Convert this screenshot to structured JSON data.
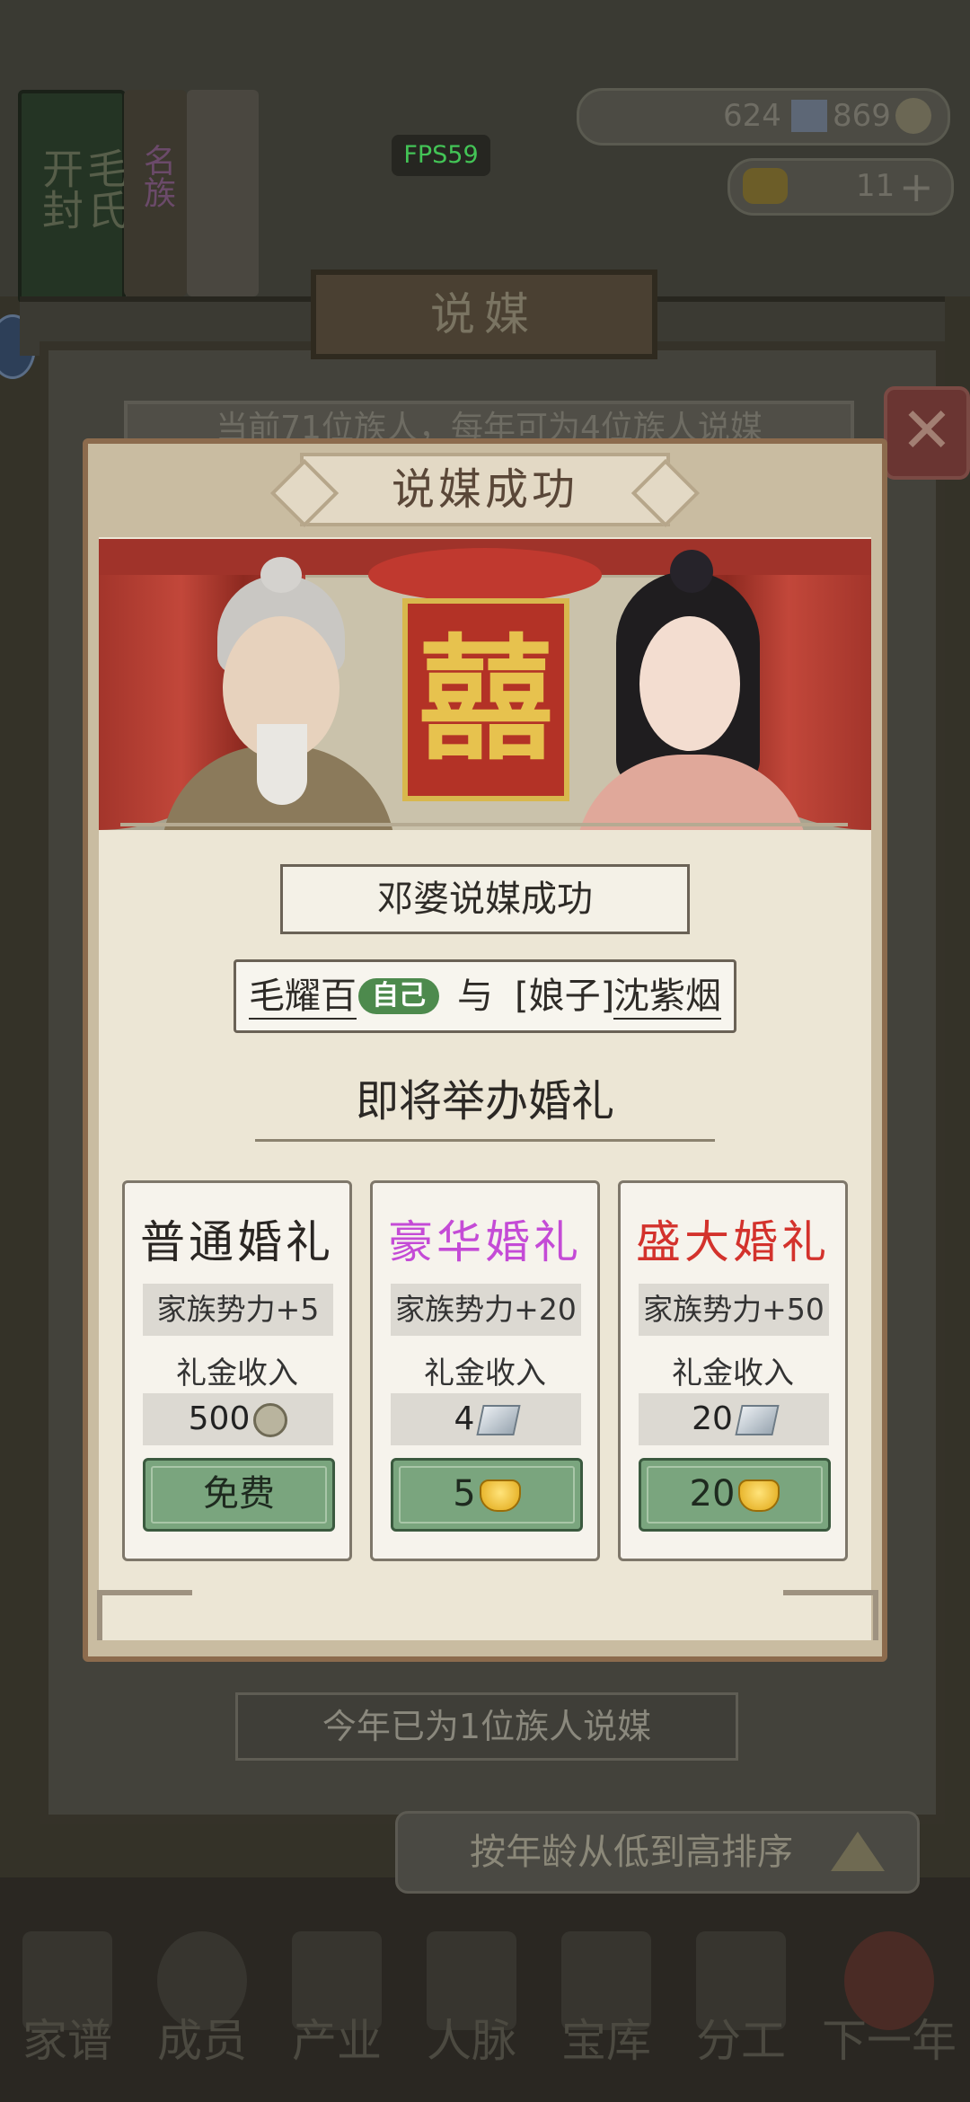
{
  "hud": {
    "fps": "FPS59",
    "resource_top": "624",
    "resource_top2": "869",
    "gold_count": "11",
    "banner_family": "毛氏",
    "banner_city": "开封",
    "banner_list": "名族"
  },
  "board": {
    "title": "说媒",
    "info_strip": "当前71位族人，每年可为4位族人说媒",
    "year_status": "今年已为1位族人说媒",
    "sort_label": "按年龄从低到高排序"
  },
  "modal": {
    "title": "说媒成功",
    "scene_symbol": "囍",
    "matchmaker_text": "邓婆说媒成功",
    "groom_name": "毛耀百",
    "self_badge": "自己",
    "and_text": "与",
    "bride_title": "[娘子]",
    "bride_name": "沈紫烟",
    "announcement": "即将举办婚礼",
    "gift_label": "礼金收入",
    "options": [
      {
        "title": "普通婚礼",
        "title_color": "#2a2623",
        "power": "家族势力+5",
        "amount": "500",
        "amount_icon": "copper-coin-icon",
        "cost": "免费",
        "cost_icon": ""
      },
      {
        "title": "豪华婚礼",
        "title_color": "#c44bd6",
        "power": "家族势力+20",
        "amount": "4",
        "amount_icon": "silver-ingot-icon",
        "cost": "5",
        "cost_icon": "gold-ingot-icon"
      },
      {
        "title": "盛大婚礼",
        "title_color": "#d3322c",
        "power": "家族势力+50",
        "amount": "20",
        "amount_icon": "silver-ingot-icon",
        "cost": "20",
        "cost_icon": "gold-ingot-icon"
      }
    ]
  },
  "nav": {
    "items": [
      {
        "label": "家谱"
      },
      {
        "label": "成员"
      },
      {
        "label": "产业"
      },
      {
        "label": "人脉"
      },
      {
        "label": "宝库"
      },
      {
        "label": "分工"
      },
      {
        "label": "下一年"
      }
    ]
  }
}
